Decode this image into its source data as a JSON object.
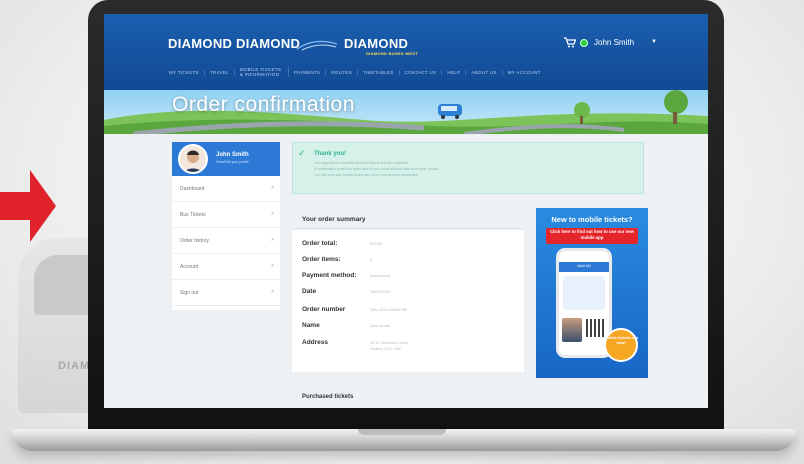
{
  "header": {
    "logos": [
      "DIAMOND",
      "DIAMOND",
      "DIAMOND"
    ],
    "logo_subtitle": "DIAMOND BUSES WEST",
    "user_name": "John Smith",
    "nav": [
      "MY TICKETS",
      "TRAVEL",
      "MOBILE TICKETS & INFORMATION",
      "PAYMENTS",
      "ROUTES",
      "TIMETABLES",
      "CONTACT US",
      "HELP",
      "ABOUT US",
      "MY ACCOUNT"
    ]
  },
  "page_title": "Order confirmation",
  "sidebar": {
    "profile_name": "John Smith",
    "profile_sub": "View/Edit your profile",
    "items": [
      {
        "label": "Dashboard"
      },
      {
        "label": "Bus Tickets"
      },
      {
        "label": "Order history"
      },
      {
        "label": "Account"
      },
      {
        "label": "Sign out"
      }
    ]
  },
  "thanks": {
    "title": "Thank you!",
    "lines": [
      "Your payment is complete and your tickets are now available.",
      "A confirmation email has been sent to your email address with your order details.",
      "You can view your tickets at any time from your account dashboard."
    ]
  },
  "summary": {
    "title": "Your order summary",
    "rows": [
      {
        "label": "Order total:",
        "value": "£45.00"
      },
      {
        "label": "Order items:",
        "value": "5"
      },
      {
        "label": "Payment method:",
        "value": "Mastercard"
      },
      {
        "label": "Date",
        "value": "12/03/2016"
      },
      {
        "label": "Order number",
        "value": "DBL-2016-00456789"
      },
      {
        "label": "Name",
        "value": "John Smith"
      },
      {
        "label": "Address",
        "value": "10 St. Andrews Close, Dudley, DY1 1AB"
      }
    ],
    "purchased_title": "Purchased tickets"
  },
  "promo": {
    "title": "New to mobile tickets?",
    "button": "Click here to find out how to use our new mobile app",
    "phone_header": "Adult M1",
    "badge": "Mobile tickets out now!"
  },
  "background": {
    "bus_text": "DIAM"
  },
  "colors": {
    "header_blue": "#124a93",
    "accent_red": "#e4262a",
    "success_green": "#2fb38d",
    "promo_blue": "#1766c6"
  }
}
